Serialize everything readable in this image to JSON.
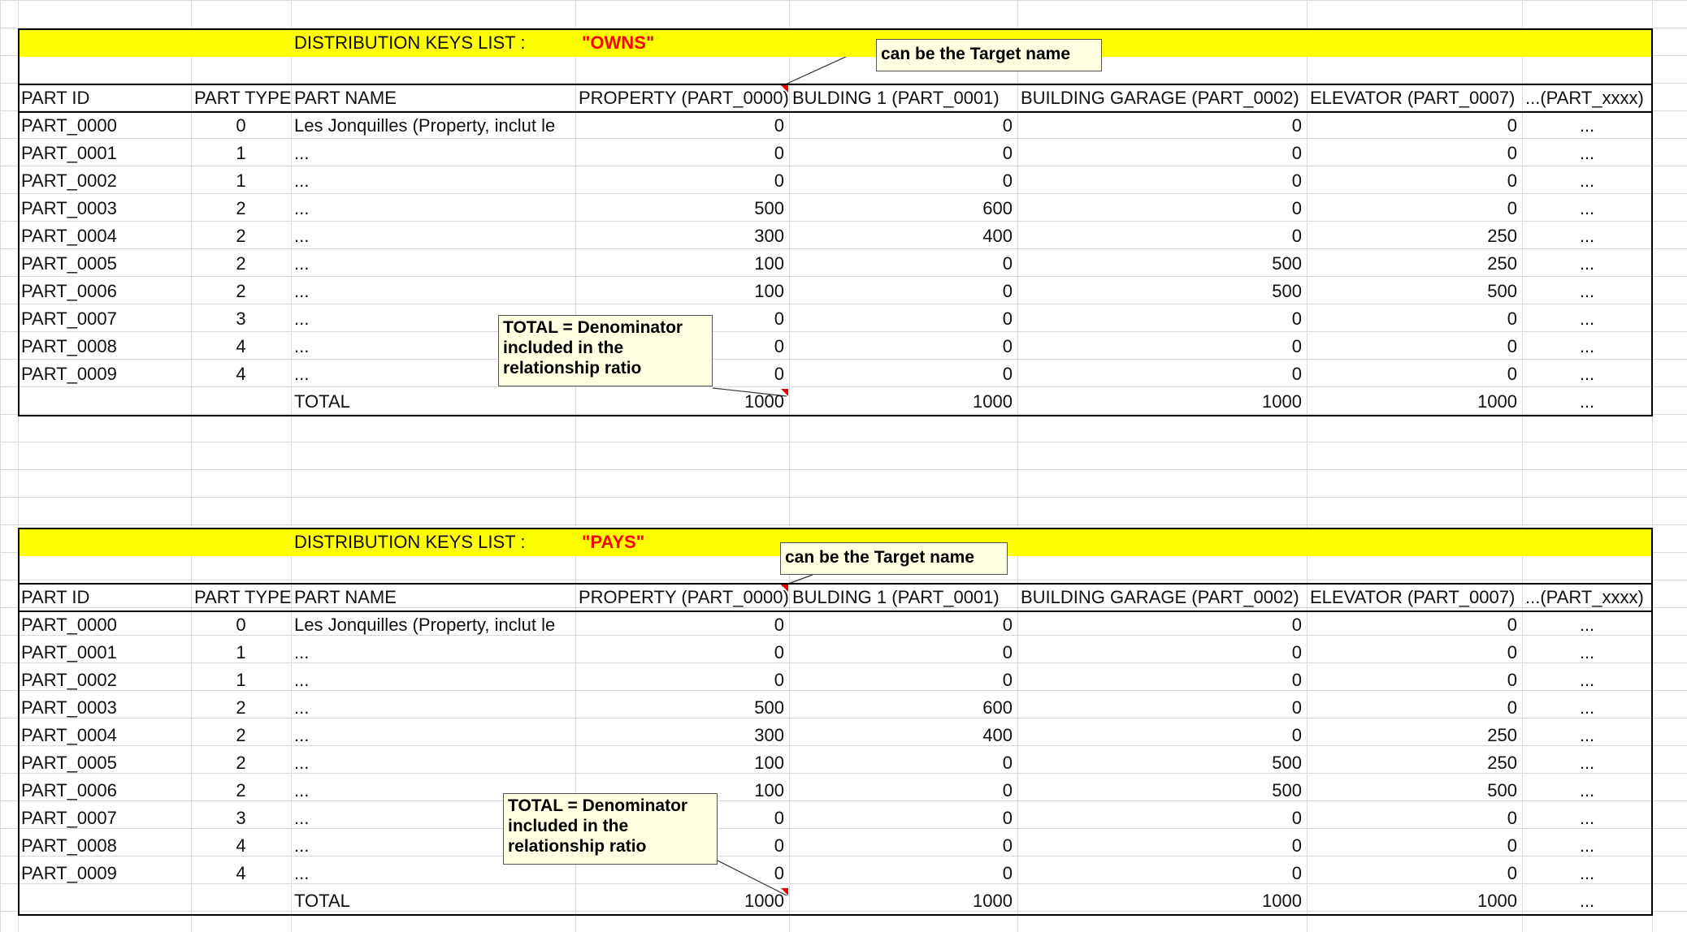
{
  "columns": [
    "PART ID",
    "PART TYPE",
    "PART NAME",
    "PROPERTY (PART_0000)",
    "BULDING 1 (PART_0001)",
    "BUILDING GARAGE (PART_0002)",
    "ELEVATOR (PART_0007)",
    "...(PART_xxxx)"
  ],
  "rows": [
    [
      "PART_0000",
      "0",
      "Les Jonquilles (Property, inclut le",
      "0",
      "0",
      "0",
      "0",
      "..."
    ],
    [
      "PART_0001",
      "1",
      "...",
      "0",
      "0",
      "0",
      "0",
      "..."
    ],
    [
      "PART_0002",
      "1",
      "...",
      "0",
      "0",
      "0",
      "0",
      "..."
    ],
    [
      "PART_0003",
      "2",
      "...",
      "500",
      "600",
      "0",
      "0",
      "..."
    ],
    [
      "PART_0004",
      "2",
      "...",
      "300",
      "400",
      "0",
      "250",
      "..."
    ],
    [
      "PART_0005",
      "2",
      "...",
      "100",
      "0",
      "500",
      "250",
      "..."
    ],
    [
      "PART_0006",
      "2",
      "...",
      "100",
      "0",
      "500",
      "500",
      "..."
    ],
    [
      "PART_0007",
      "3",
      "...",
      "0",
      "0",
      "0",
      "0",
      "..."
    ],
    [
      "PART_0008",
      "4",
      "...",
      "0",
      "0",
      "0",
      "0",
      "..."
    ],
    [
      "PART_0009",
      "4",
      "...",
      "0",
      "0",
      "0",
      "0",
      "..."
    ]
  ],
  "total_row": [
    "",
    "",
    "TOTAL",
    "1000",
    "1000",
    "1000",
    "1000",
    "..."
  ],
  "sections": [
    {
      "list_label": "DISTRIBUTION KEYS LIST :",
      "list_name": "\"OWNS\"",
      "comment_target": "can be the Target name",
      "comment_total": "TOTAL = Denominator included in the relationship ratio"
    },
    {
      "list_label": "DISTRIBUTION KEYS LIST :",
      "list_name": "\"PAYS\"",
      "comment_target": "can be the Target name",
      "comment_total": "TOTAL = Denominator included in the relationship ratio"
    }
  ],
  "colors": {
    "highlight": "#ffff00",
    "list_name": "#ff0000",
    "comment_bg": "#ffffe1",
    "comment_marker": "#e00000"
  }
}
